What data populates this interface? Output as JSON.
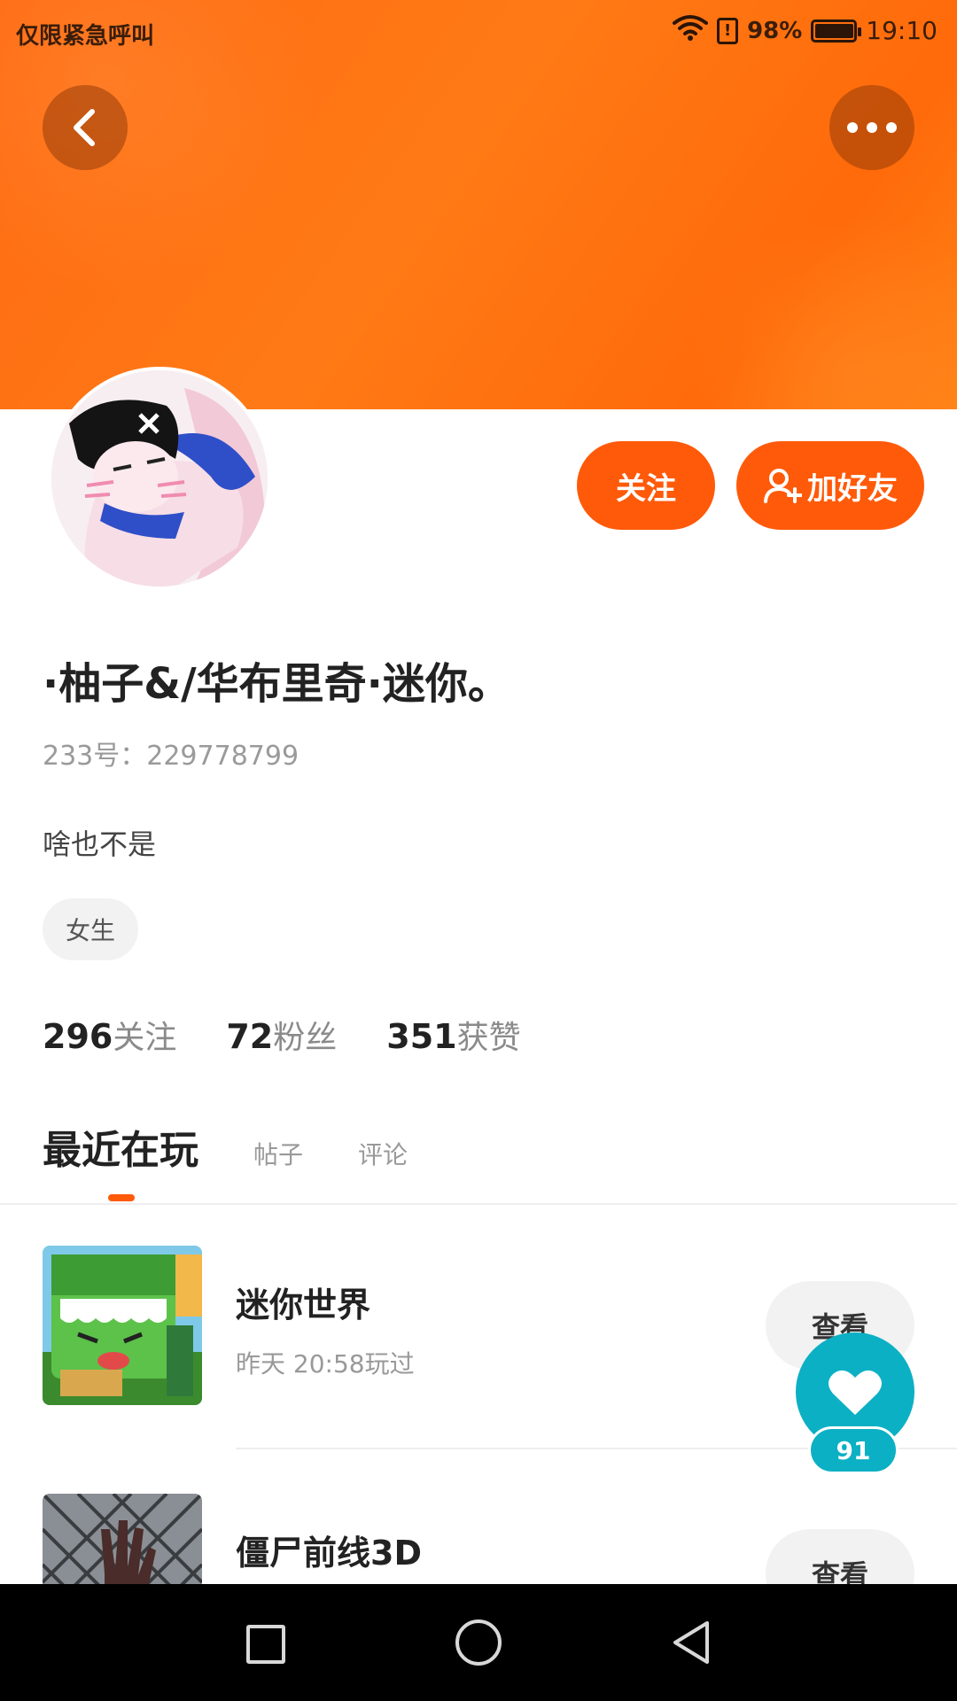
{
  "status_bar": {
    "emergency_text": "仅限紧急呼叫",
    "battery_percent": "98%",
    "time": "19:10",
    "icons": [
      "wifi-icon",
      "alert-icon",
      "battery-icon"
    ]
  },
  "header": {
    "back_icon": "chevron-left-icon",
    "more_icon": "more-dots-icon",
    "gradient_colors": [
      "#ff6a12",
      "#ff8215"
    ]
  },
  "profile": {
    "avatar": "avatar",
    "follow_label": "关注",
    "add_friend_label": "加好友",
    "nickname": "·柚子&/华布里奇·迷你。",
    "uid": "233号：229778799",
    "bio": "啥也不是",
    "tag": "女生"
  },
  "stats": [
    {
      "num": "296",
      "label": "关注"
    },
    {
      "num": "72",
      "label": "粉丝"
    },
    {
      "num": "351",
      "label": "获赞"
    }
  ],
  "tabs": [
    {
      "label": "最近在玩",
      "active": true
    },
    {
      "label": "帖子",
      "active": false
    },
    {
      "label": "评论",
      "active": false
    }
  ],
  "games": [
    {
      "title": "迷你世界",
      "subtitle": "昨天  20:58玩过",
      "button": "查看"
    },
    {
      "title": "僵尸前线3D",
      "subtitle": "",
      "button": "查看"
    }
  ],
  "like_widget": {
    "count": "91",
    "icon": "heart-icon"
  },
  "nav_bar": {
    "icons": [
      "recent-apps-icon",
      "home-icon",
      "back-icon"
    ]
  },
  "colors": {
    "accent": "#ff5a0a",
    "like": "#0cb0c4"
  }
}
